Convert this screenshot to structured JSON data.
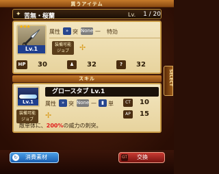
{
  "header": {
    "title": "買うアイテム"
  },
  "item": {
    "name": "苦無・桜蘭",
    "level_label": "Lv.",
    "level_value": "1 / 20",
    "icon_level": "Lv.1",
    "rarity_stars": "★★★"
  },
  "attributes": {
    "label": "属性",
    "pierce_label": "突",
    "none_chip": "None",
    "dash": "—",
    "special_label": "特効"
  },
  "equip": {
    "label_line1": "装備可能",
    "label_line2": "ジョブ"
  },
  "stats": {
    "hp_label": "HP",
    "hp_value": "30",
    "attack_value": "32",
    "magic_value": "32"
  },
  "skill": {
    "section_title": "スキル",
    "name": "グロースタブ Lv.1",
    "icon_level": "Lv.1",
    "attr_label": "属性",
    "pierce_label": "突",
    "none_chip": "None",
    "dash": "—",
    "single_label": "単",
    "ct_label": "CT",
    "ct_value": "10",
    "ap_label": "AP",
    "ap_value": "15",
    "desc_prefix": "敵単体に、",
    "desc_highlight": "200%",
    "desc_suffix": "の威力の刺突。"
  },
  "side_tab": {
    "label": "SELECT"
  },
  "footer": {
    "material_button": "消費素材",
    "exchange_button": "交換",
    "exchange_icon": "GT"
  },
  "colors": {
    "accent_gold": "#c89a45",
    "panel_bg": "#f3e6c0",
    "highlight_red": "#e01a1a",
    "button_blue": "#1a5fb0",
    "button_red": "#c83a32"
  }
}
